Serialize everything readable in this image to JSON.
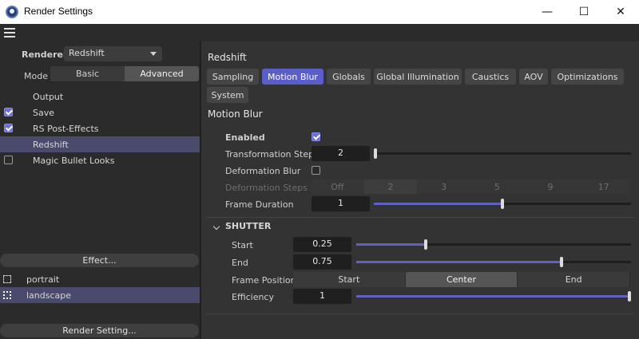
{
  "window": {
    "title": "Render Settings",
    "minimize": "—",
    "maximize": "☐",
    "close": "✕"
  },
  "left": {
    "renderer_label": "Renderer",
    "renderer_value": "Redshift",
    "mode_label": "Mode",
    "mode_options": [
      "Basic",
      "Advanced"
    ],
    "mode_selected": "Advanced",
    "tree": [
      {
        "label": "Output",
        "check": "none",
        "selected": false
      },
      {
        "label": "Save",
        "check": "on",
        "selected": false
      },
      {
        "label": "RS Post-Effects",
        "check": "on",
        "selected": false
      },
      {
        "label": "Redshift",
        "check": "none",
        "selected": true
      },
      {
        "label": "Magic Bullet Looks",
        "check": "off",
        "selected": false
      }
    ],
    "effect_button": "Effect...",
    "presets": [
      {
        "label": "portrait",
        "selected": false
      },
      {
        "label": "landscape",
        "selected": true
      }
    ],
    "render_setting_button": "Render Setting..."
  },
  "right": {
    "title": "Redshift",
    "tabs": [
      "Sampling",
      "Motion Blur",
      "Globals",
      "Global Illumination",
      "Caustics",
      "AOV",
      "Optimizations",
      "System"
    ],
    "active_tab": "Motion Blur",
    "section_title": "Motion Blur",
    "enabled_label": "Enabled",
    "enabled": true,
    "transformation_steps_label": "Transformation Steps",
    "transformation_steps": "2",
    "transformation_steps_level": 0.0,
    "deformation_blur_label": "Deformation Blur",
    "deformation_blur": false,
    "deformation_steps_label": "Deformation Steps",
    "deformation_steps_options": [
      "Off",
      "2",
      "3",
      "5",
      "9",
      "17"
    ],
    "deformation_steps_selected": "2",
    "frame_duration_label": "Frame Duration",
    "frame_duration": "1",
    "frame_duration_level": 0.5,
    "shutter": {
      "title": "SHUTTER",
      "start_label": "Start",
      "start": "0.25",
      "start_level": 0.25,
      "end_label": "End",
      "end": "0.75",
      "end_level": 0.75,
      "frame_position_label": "Frame Position",
      "frame_position_options": [
        "Start",
        "Center",
        "End"
      ],
      "frame_position_selected": "Center",
      "efficiency_label": "Efficiency",
      "efficiency": "1",
      "efficiency_level": 1.0
    }
  },
  "colors": {
    "accent": "#5a5ec8",
    "selection": "#494a6c",
    "panel": "#2b2b2b",
    "background": "#333333"
  }
}
